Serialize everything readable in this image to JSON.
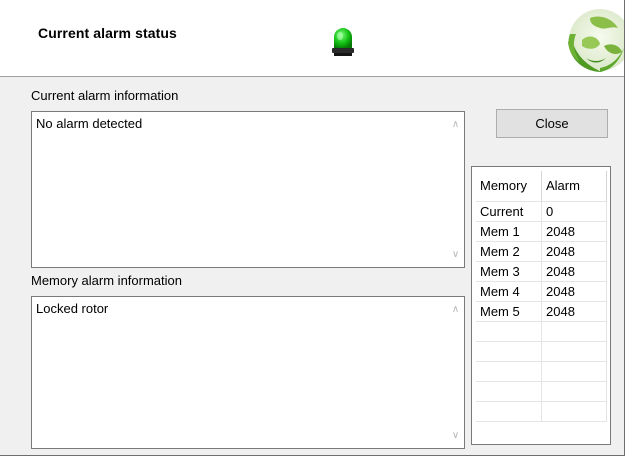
{
  "header": {
    "title": "Current alarm status",
    "status_led_color": "#1db31d",
    "logo_icon": "globe-leaf-logo"
  },
  "current_alarm": {
    "label": "Current alarm information",
    "text": "No alarm detected"
  },
  "memory_alarm": {
    "label": "Memory alarm information",
    "text": "Locked rotor"
  },
  "close_button": {
    "label": "Close"
  },
  "alarm_table": {
    "columns": [
      "Memory",
      "Alarm"
    ],
    "rows": [
      [
        "Current",
        "0"
      ],
      [
        "Mem 1",
        "2048"
      ],
      [
        "Mem 2",
        "2048"
      ],
      [
        "Mem 3",
        "2048"
      ],
      [
        "Mem 4",
        "2048"
      ],
      [
        "Mem 5",
        "2048"
      ]
    ]
  }
}
